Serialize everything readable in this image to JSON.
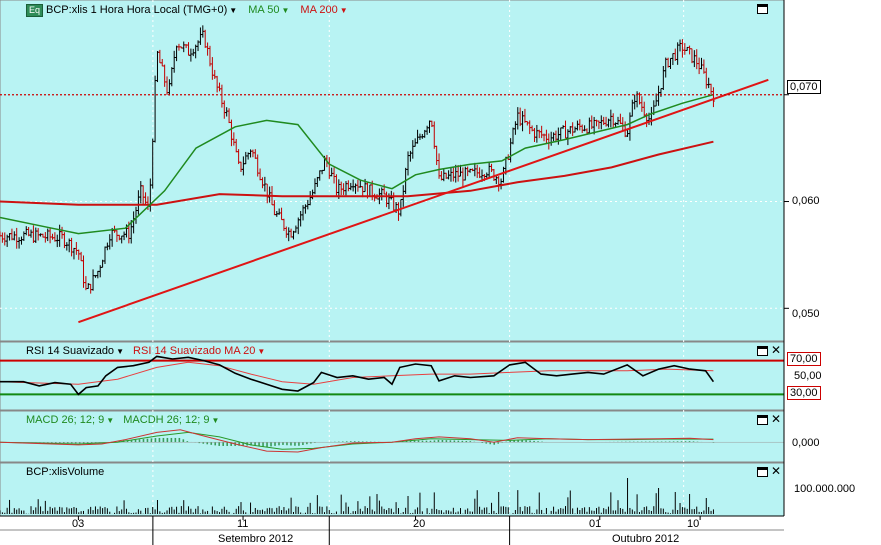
{
  "colors": {
    "panel_bg": "#b8f3f3",
    "candle_up": "#000000",
    "candle_down": "#c00000",
    "ma50": "#1f8a1f",
    "ma200": "#cc1111",
    "trendline": "#e01515",
    "ref_line": "#cc0000",
    "rsi": "#000000",
    "rsi_smooth": "#e84040",
    "rsi_upper": "#cc0000",
    "rsi_lower": "#118811",
    "macd": "#cc3333",
    "macd_signal": "#2a9a2a",
    "macd_hist": "#3a9a5a",
    "volume": "#000000"
  },
  "price_panel": {
    "eq_badge": "Eq",
    "title": "BCP:xlis 1 Hora Hora Local (TMG+0)",
    "ma50_label": "MA 50",
    "ma200_label": "MA 200",
    "current_price_label": "0,070",
    "y_ticks": [
      "0,060",
      "0,050"
    ]
  },
  "rsi_panel": {
    "title": "RSI 14 Suavizado",
    "sub_label": "RSI 14 Suavizado MA 20",
    "level_high": "70,00",
    "level_mid": "50,00",
    "level_low": "30,00"
  },
  "macd_panel": {
    "title": "MACD 26; 12; 9",
    "hist_label": "MACDH 26; 12; 9",
    "zero_label": "0,000"
  },
  "volume_panel": {
    "title": "BCP:xlisVolume",
    "tick_label": "100.000.000"
  },
  "x_axis": {
    "day_labels": [
      "03",
      "11",
      "20",
      "01",
      "10"
    ],
    "month_labels": [
      "Setembro 2012",
      "Outubro 2012"
    ]
  },
  "chart_data": {
    "type": "line",
    "title": "BCP:xlis 1 Hora Hora Local (TMG+0)",
    "x_axis": "hourly bars, 3 Sep 2012 - 11 Oct 2012",
    "y_unit": "EUR",
    "ylim": [
      0.0475,
      0.077
    ],
    "current_price": 0.07,
    "series": [
      {
        "name": "BCP:xlis (close)",
        "points": [
          [
            0,
            0.0568
          ],
          [
            0.04,
            0.0568
          ],
          [
            0.08,
            0.0566
          ],
          [
            0.1,
            0.0553
          ],
          [
            0.11,
            0.0515
          ],
          [
            0.125,
            0.0535
          ],
          [
            0.14,
            0.057
          ],
          [
            0.165,
            0.057
          ],
          [
            0.18,
            0.061
          ],
          [
            0.19,
            0.059
          ],
          [
            0.2,
            0.074
          ],
          [
            0.215,
            0.07
          ],
          [
            0.225,
            0.075
          ],
          [
            0.24,
            0.074
          ],
          [
            0.26,
            0.0755
          ],
          [
            0.275,
            0.071
          ],
          [
            0.29,
            0.068
          ],
          [
            0.305,
            0.063
          ],
          [
            0.32,
            0.065
          ],
          [
            0.335,
            0.062
          ],
          [
            0.35,
            0.059
          ],
          [
            0.37,
            0.057
          ],
          [
            0.385,
            0.059
          ],
          [
            0.4,
            0.061
          ],
          [
            0.415,
            0.064
          ],
          [
            0.43,
            0.061
          ],
          [
            0.45,
            0.062
          ],
          [
            0.47,
            0.061
          ],
          [
            0.49,
            0.0605
          ],
          [
            0.51,
            0.059
          ],
          [
            0.52,
            0.064
          ],
          [
            0.535,
            0.066
          ],
          [
            0.55,
            0.068
          ],
          [
            0.56,
            0.062
          ],
          [
            0.58,
            0.0625
          ],
          [
            0.6,
            0.0625
          ],
          [
            0.62,
            0.063
          ],
          [
            0.64,
            0.062
          ],
          [
            0.66,
            0.068
          ],
          [
            0.68,
            0.0665
          ],
          [
            0.7,
            0.066
          ],
          [
            0.72,
            0.0665
          ],
          [
            0.74,
            0.067
          ],
          [
            0.76,
            0.067
          ],
          [
            0.78,
            0.068
          ],
          [
            0.8,
            0.0665
          ],
          [
            0.81,
            0.07
          ],
          [
            0.83,
            0.0675
          ],
          [
            0.85,
            0.073
          ],
          [
            0.87,
            0.0745
          ],
          [
            0.89,
            0.073
          ],
          [
            0.9,
            0.0715
          ],
          [
            0.91,
            0.07
          ]
        ]
      },
      {
        "name": "MA 50",
        "points": [
          [
            0,
            0.0585
          ],
          [
            0.06,
            0.0576
          ],
          [
            0.1,
            0.057
          ],
          [
            0.16,
            0.0575
          ],
          [
            0.21,
            0.061
          ],
          [
            0.25,
            0.065
          ],
          [
            0.3,
            0.067
          ],
          [
            0.34,
            0.0676
          ],
          [
            0.38,
            0.0672
          ],
          [
            0.42,
            0.0635
          ],
          [
            0.46,
            0.062
          ],
          [
            0.5,
            0.0612
          ],
          [
            0.53,
            0.0625
          ],
          [
            0.56,
            0.063
          ],
          [
            0.6,
            0.0635
          ],
          [
            0.64,
            0.0638
          ],
          [
            0.67,
            0.065
          ],
          [
            0.72,
            0.0658
          ],
          [
            0.76,
            0.0665
          ],
          [
            0.8,
            0.0672
          ],
          [
            0.83,
            0.0682
          ],
          [
            0.87,
            0.0692
          ],
          [
            0.91,
            0.07
          ]
        ]
      },
      {
        "name": "MA 200",
        "points": [
          [
            0,
            0.06
          ],
          [
            0.1,
            0.0597
          ],
          [
            0.2,
            0.0597
          ],
          [
            0.28,
            0.0607
          ],
          [
            0.36,
            0.0605
          ],
          [
            0.44,
            0.0605
          ],
          [
            0.52,
            0.0605
          ],
          [
            0.6,
            0.061
          ],
          [
            0.66,
            0.0618
          ],
          [
            0.72,
            0.0624
          ],
          [
            0.78,
            0.0632
          ],
          [
            0.84,
            0.0644
          ],
          [
            0.91,
            0.0656
          ]
        ]
      },
      {
        "name": "trendline",
        "points": [
          [
            0.1,
            0.0487
          ],
          [
            0.98,
            0.0714
          ]
        ]
      }
    ],
    "indicators": {
      "rsi_levels": [
        70,
        50,
        30
      ],
      "rsi_range": [
        15,
        85
      ],
      "rsi": [
        [
          0,
          45
        ],
        [
          0.03,
          45
        ],
        [
          0.05,
          40
        ],
        [
          0.07,
          44
        ],
        [
          0.09,
          42
        ],
        [
          0.1,
          30
        ],
        [
          0.11,
          38
        ],
        [
          0.125,
          40
        ],
        [
          0.135,
          52
        ],
        [
          0.15,
          62
        ],
        [
          0.17,
          64
        ],
        [
          0.19,
          68
        ],
        [
          0.2,
          75
        ],
        [
          0.22,
          72
        ],
        [
          0.24,
          74
        ],
        [
          0.26,
          70
        ],
        [
          0.28,
          65
        ],
        [
          0.3,
          55
        ],
        [
          0.32,
          48
        ],
        [
          0.34,
          42
        ],
        [
          0.36,
          36
        ],
        [
          0.38,
          34
        ],
        [
          0.4,
          44
        ],
        [
          0.41,
          56
        ],
        [
          0.43,
          50
        ],
        [
          0.45,
          52
        ],
        [
          0.47,
          48
        ],
        [
          0.49,
          50
        ],
        [
          0.5,
          42
        ],
        [
          0.51,
          62
        ],
        [
          0.53,
          66
        ],
        [
          0.55,
          64
        ],
        [
          0.56,
          46
        ],
        [
          0.58,
          52
        ],
        [
          0.6,
          50
        ],
        [
          0.63,
          52
        ],
        [
          0.65,
          65
        ],
        [
          0.67,
          68
        ],
        [
          0.69,
          54
        ],
        [
          0.71,
          52
        ],
        [
          0.73,
          54
        ],
        [
          0.75,
          56
        ],
        [
          0.77,
          54
        ],
        [
          0.8,
          65
        ],
        [
          0.82,
          52
        ],
        [
          0.84,
          60
        ],
        [
          0.86,
          64
        ],
        [
          0.88,
          60
        ],
        [
          0.9,
          58
        ],
        [
          0.91,
          45
        ]
      ],
      "rsi_smooth": [
        [
          0,
          45
        ],
        [
          0.1,
          42
        ],
        [
          0.15,
          48
        ],
        [
          0.2,
          62
        ],
        [
          0.24,
          68
        ],
        [
          0.28,
          64
        ],
        [
          0.32,
          54
        ],
        [
          0.36,
          45
        ],
        [
          0.4,
          42
        ],
        [
          0.45,
          50
        ],
        [
          0.5,
          52
        ],
        [
          0.55,
          54
        ],
        [
          0.6,
          54
        ],
        [
          0.65,
          56
        ],
        [
          0.7,
          58
        ],
        [
          0.75,
          58
        ],
        [
          0.8,
          58
        ],
        [
          0.85,
          60
        ],
        [
          0.91,
          58
        ]
      ],
      "macd_range": [
        -2,
        1.6
      ],
      "macd": [
        [
          0,
          0
        ],
        [
          0.1,
          -0.3
        ],
        [
          0.13,
          -0.2
        ],
        [
          0.16,
          0.3
        ],
        [
          0.2,
          1.1
        ],
        [
          0.23,
          1.4
        ],
        [
          0.26,
          0.7
        ],
        [
          0.3,
          -0.2
        ],
        [
          0.34,
          -1.0
        ],
        [
          0.38,
          -1.1
        ],
        [
          0.41,
          -0.6
        ],
        [
          0.45,
          -0.1
        ],
        [
          0.5,
          0
        ],
        [
          0.53,
          0.4
        ],
        [
          0.56,
          0.6
        ],
        [
          0.6,
          0.4
        ],
        [
          0.63,
          0
        ],
        [
          0.66,
          0.5
        ],
        [
          0.7,
          0.4
        ],
        [
          0.75,
          0.3
        ],
        [
          0.8,
          0.35
        ],
        [
          0.84,
          0.4
        ],
        [
          0.88,
          0.45
        ],
        [
          0.91,
          0.3
        ]
      ],
      "macd_signal": [
        [
          0,
          0
        ],
        [
          0.1,
          -0.2
        ],
        [
          0.15,
          0
        ],
        [
          0.2,
          0.7
        ],
        [
          0.24,
          1.1
        ],
        [
          0.28,
          0.6
        ],
        [
          0.32,
          -0.3
        ],
        [
          0.36,
          -0.8
        ],
        [
          0.4,
          -0.7
        ],
        [
          0.45,
          -0.2
        ],
        [
          0.5,
          0
        ],
        [
          0.55,
          0.4
        ],
        [
          0.6,
          0.3
        ],
        [
          0.65,
          0.2
        ],
        [
          0.7,
          0.4
        ],
        [
          0.75,
          0.3
        ],
        [
          0.8,
          0.3
        ],
        [
          0.85,
          0.35
        ],
        [
          0.91,
          0.35
        ]
      ],
      "volume_tick": 100000000
    }
  }
}
